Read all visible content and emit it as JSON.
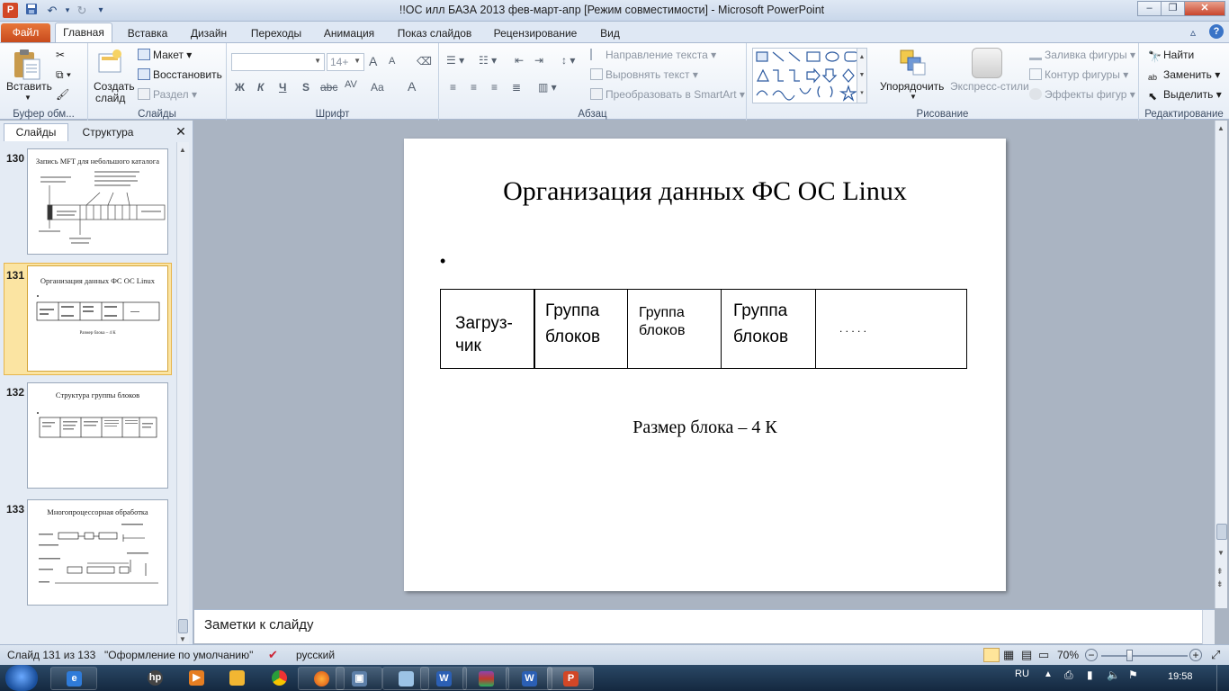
{
  "titlebar": {
    "app_icon": "P",
    "title": "!!ОС илл БАЗА  2013 фев-март-апр [Режим совместимости]  -  Microsoft PowerPoint",
    "minimize": "–",
    "maximize": "❐",
    "close": "✕"
  },
  "tabs": {
    "file": "Файл",
    "home": "Главная",
    "insert": "Вставка",
    "design": "Дизайн",
    "transitions": "Переходы",
    "animation": "Анимация",
    "slideshow": "Показ слайдов",
    "review": "Рецензирование",
    "view": "Вид"
  },
  "ribbon": {
    "clipboard": {
      "paste": "Вставить",
      "label": "Буфер обм..."
    },
    "slides": {
      "new_slide_1": "Создать",
      "new_slide_2": "слайд",
      "layout": "Макет",
      "reset": "Восстановить",
      "section": "Раздел",
      "label": "Слайды"
    },
    "font": {
      "font_size": "14+",
      "bold": "Ж",
      "italic": "К",
      "underline": "Ч",
      "shadow": "S",
      "strike": "abc",
      "spacing": "AV",
      "case": "Aa",
      "color": "A",
      "grow": "A",
      "shrink": "A",
      "label": "Шрифт"
    },
    "paragraph": {
      "text_direction": "Направление текста",
      "align_text": "Выровнять текст",
      "smartart": "Преобразовать в SmartArt",
      "label": "Абзац"
    },
    "drawing": {
      "arrange": "Упорядочить",
      "quick_styles": "Экспресс-стили",
      "fill": "Заливка фигуры",
      "outline": "Контур фигуры",
      "effects": "Эффекты фигур",
      "label": "Рисование"
    },
    "editing": {
      "find": "Найти",
      "replace": "Заменить",
      "select": "Выделить",
      "label": "Редактирование"
    }
  },
  "left_panel": {
    "tab_slides": "Слайды",
    "tab_outline": "Структура",
    "close": "✕",
    "thumbnails": [
      {
        "number": "130",
        "title": "Запись MFT для небольшого каталога"
      },
      {
        "number": "131",
        "title": "Организация данных ФС ОС Linux",
        "caption": "Размер блока – 4 К"
      },
      {
        "number": "132",
        "title": "Структура группы блоков"
      },
      {
        "number": "133",
        "title": "Многопроцессорная обработка"
      }
    ]
  },
  "slide": {
    "title": "Организация данных ФС ОС Linux",
    "bullet": "•",
    "cells": [
      {
        "line1": "Загруз-",
        "line2": "чик"
      },
      {
        "line1": "Группа",
        "line2": "блоков"
      },
      {
        "line1": "Группа",
        "line2": "блоков"
      },
      {
        "line1": "Группа",
        "line2": "блоков"
      },
      {
        "line1": ". . . . .",
        "line2": ""
      }
    ],
    "caption": "Размер блока – 4 К"
  },
  "notes": {
    "placeholder": "Заметки к слайду"
  },
  "statusbar": {
    "slide_info": "Слайд 131 из 133",
    "theme": "\"Оформление по умолчанию\"",
    "language": "русский",
    "zoom": "70%"
  },
  "taskbar": {
    "language": "RU",
    "time": "19:58"
  }
}
